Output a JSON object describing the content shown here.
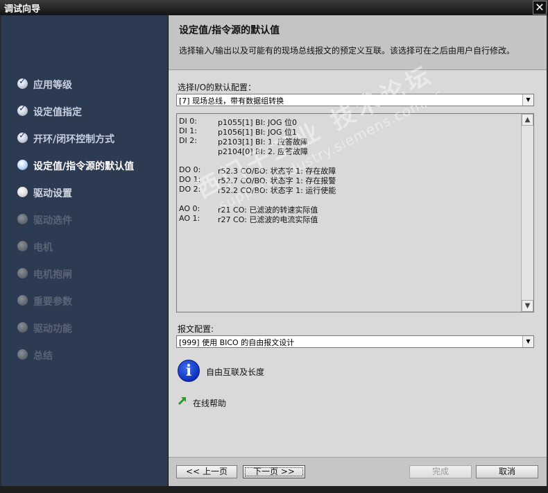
{
  "window": {
    "title": "调试向导",
    "close_icon": "close-icon"
  },
  "sidebar": {
    "steps": [
      {
        "label": "应用等级",
        "state": "done"
      },
      {
        "label": "设定值指定",
        "state": "done"
      },
      {
        "label": "开环/闭环控制方式",
        "state": "done"
      },
      {
        "label": "设定值/指令源的默认值",
        "state": "current"
      },
      {
        "label": "驱动设置",
        "state": "next"
      },
      {
        "label": "驱动选件",
        "state": "disabled"
      },
      {
        "label": "电机",
        "state": "disabled"
      },
      {
        "label": "电机抱闸",
        "state": "disabled"
      },
      {
        "label": "重要参数",
        "state": "disabled"
      },
      {
        "label": "驱动功能",
        "state": "disabled"
      },
      {
        "label": "总结",
        "state": "disabled"
      }
    ]
  },
  "header": {
    "title": "设定值/指令源的默认值",
    "description": "选择输入/输出以及可能有的现场总线报文的预定义互联。该选择可在之后由用户自行修改。"
  },
  "io_config": {
    "label": "选择I/O的默认配置：",
    "selected": "[7] 现场总线，带有数据组转换"
  },
  "io_list": [
    {
      "key": "DI 0:",
      "value": "p1055[1] BI: JOG 位0"
    },
    {
      "key": "DI 1:",
      "value": "p1056[1] BI: JOG 位1"
    },
    {
      "key": "DI 2:",
      "value": "p2103[1] BI: 1. 应答故障"
    },
    {
      "key": "",
      "value": "p2104[0] BI: 2. 应答故障"
    },
    {
      "key": "DO 0:",
      "value": "r52.3 CO/BO: 状态字 1: 存在故障"
    },
    {
      "key": "DO 1:",
      "value": "r52.7 CO/BO: 状态字 1: 存在报警"
    },
    {
      "key": "DO 2:",
      "value": "r52.2 CO/BO: 状态字 1: 运行使能"
    },
    {
      "key": "AO 0:",
      "value": "r21 CO: 已滤波的转速实际值"
    },
    {
      "key": "AO 1:",
      "value": "r27 CO: 已滤波的电流实际值"
    }
  ],
  "watermark": {
    "line1": "西门子工业 技术论坛",
    "line2": "support.industry.siemens.com/cs"
  },
  "telegram": {
    "label": "报文配置:",
    "selected": "[999] 使用 BICO 的自由报文设计"
  },
  "info": {
    "icon": "info-icon",
    "text": "自由互联及长度"
  },
  "help": {
    "icon": "arrow-icon",
    "text": "在线帮助"
  },
  "footer": {
    "back": "<< 上一页",
    "next": "下一页 >>",
    "finish": "完成",
    "cancel": "取消"
  },
  "colors": {
    "sidebar_bg": "#2c3a52",
    "content_bg": "#d9d9d9",
    "header_bg": "#c4c4c4",
    "title_bar": "#1a1a1a",
    "info_blue": "#0a2db8",
    "help_green": "#2a9a2a"
  }
}
